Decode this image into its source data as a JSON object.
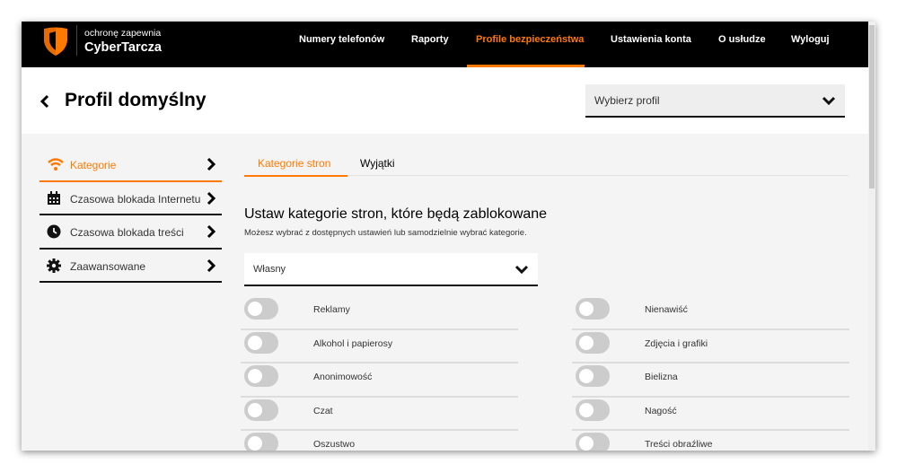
{
  "brand": {
    "tagline": "ochronę zapewnia",
    "name": "CyberTarcza",
    "accent": "#ff7900"
  },
  "nav": [
    "Numery telefonów",
    "Raporty",
    "Profile bezpieczeństwa",
    "Ustawienia konta",
    "O usłudze",
    "Wyloguj"
  ],
  "nav_active": "Profile bezpieczeństwa",
  "page": {
    "title": "Profil domyślny",
    "profile_select": "Wybierz profil"
  },
  "sidebar": {
    "items": [
      {
        "label": "Kategorie",
        "icon": "wifi-icon",
        "active": true
      },
      {
        "label": "Czasowa blokada Internetu",
        "icon": "calendar-icon"
      },
      {
        "label": "Czasowa blokada treści",
        "icon": "clock-icon"
      },
      {
        "label": "Zaawansowane",
        "icon": "gear-icon"
      }
    ]
  },
  "tabs": [
    "Kategorie stron",
    "Wyjątki"
  ],
  "content": {
    "heading": "Ustaw kategorie stron, które będą zablokowane",
    "subtitle": "Możesz wybrać z dostępnych ustawień lub samodzielnie wybrać kategorie.",
    "preset": "Własny"
  },
  "categories_left": [
    {
      "label": "Reklamy",
      "on": false
    },
    {
      "label": "Alkohol i papierosy",
      "on": false
    },
    {
      "label": "Anonimowość",
      "on": false
    },
    {
      "label": "Czat",
      "on": false
    },
    {
      "label": "Oszustwo",
      "on": false
    }
  ],
  "categories_right": [
    {
      "label": "Nienawiść",
      "on": false
    },
    {
      "label": "Zdjęcia i grafiki",
      "on": false
    },
    {
      "label": "Bielizna",
      "on": false
    },
    {
      "label": "Nagość",
      "on": false
    },
    {
      "label": "Treści obraźliwe",
      "on": false
    }
  ]
}
